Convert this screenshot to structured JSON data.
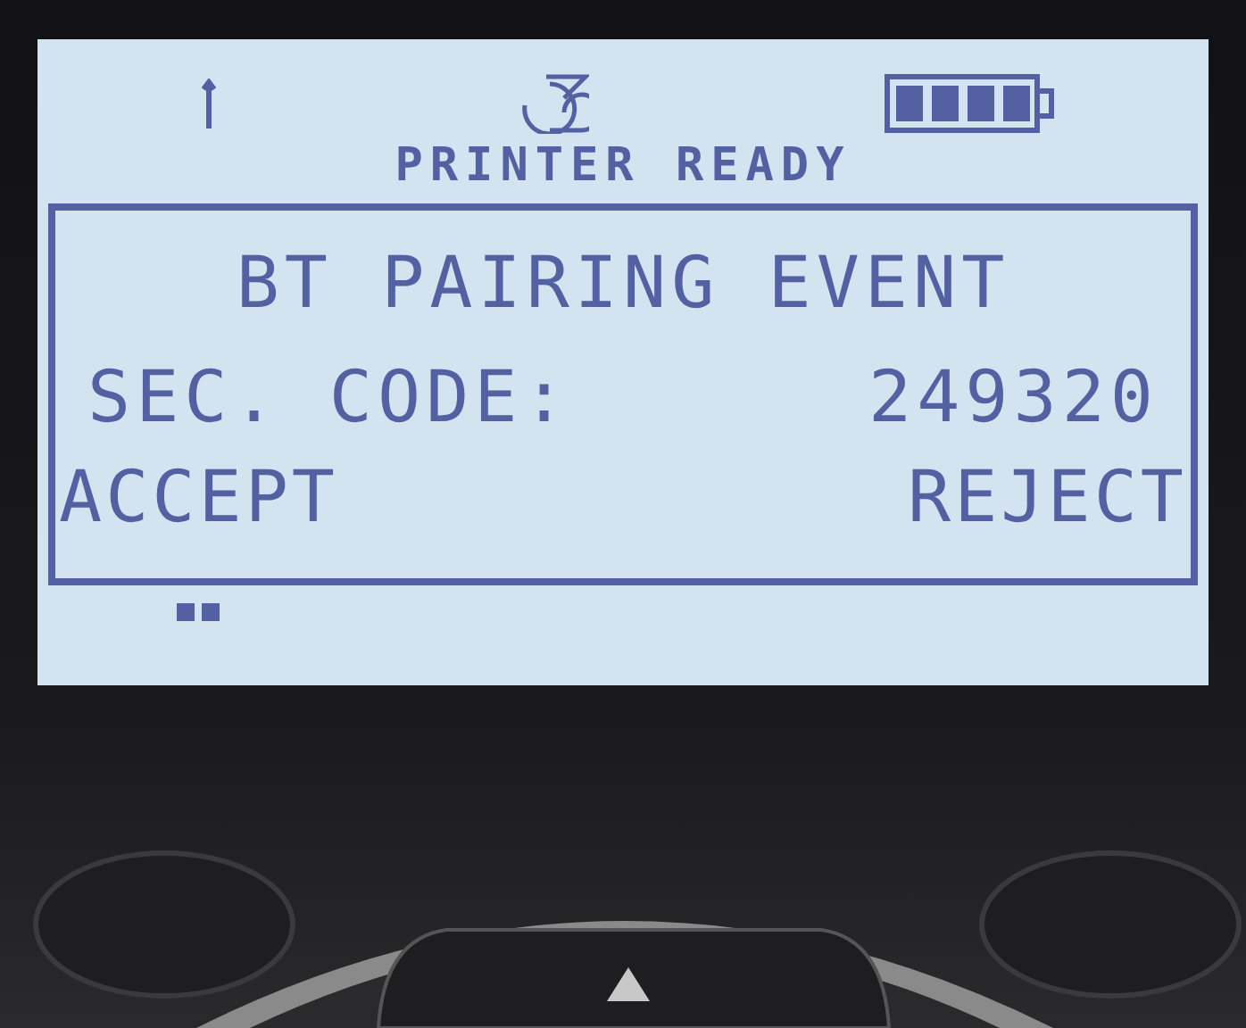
{
  "status_text": "PRINTER READY",
  "dialog": {
    "title": "BT PAIRING EVENT",
    "code_label": "SEC. CODE:",
    "code": "249320",
    "actions": [
      {
        "label": "ACCEPT"
      },
      {
        "label": "REJECT"
      }
    ]
  }
}
